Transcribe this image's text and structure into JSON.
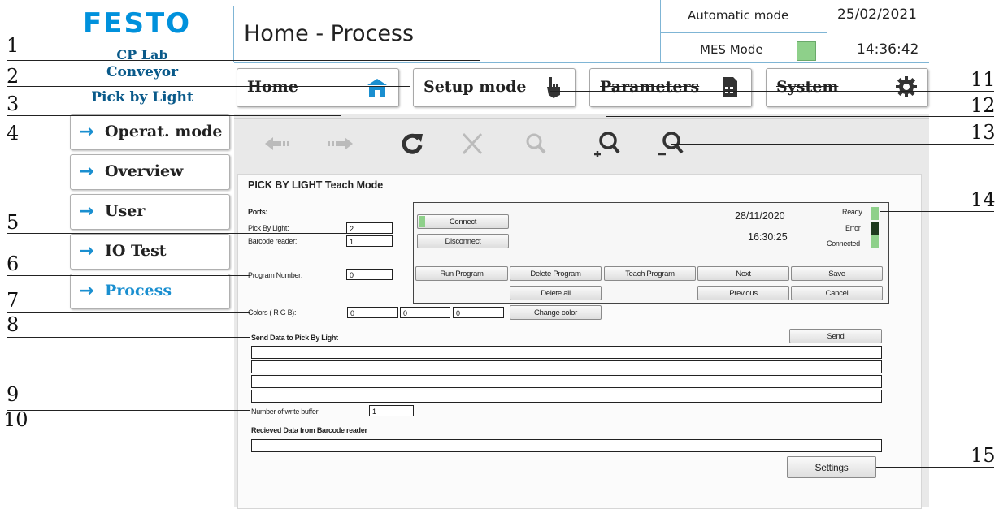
{
  "header": {
    "logo": "FESTO",
    "brand_line1": "CP Lab",
    "brand_line2": "Conveyor",
    "brand_line3": "Pick by Light",
    "title": "Home - Process",
    "mode_label": "Automatic mode",
    "mes_label": "MES Mode",
    "date": "25/02/2021",
    "time": "14:36:42",
    "mes_indicator_color": "#8ed08a"
  },
  "nav": {
    "home": "Home",
    "setup": "Setup mode",
    "parameters": "Parameters",
    "system": "System"
  },
  "sidebar": {
    "items": [
      {
        "label": "Operat. mode"
      },
      {
        "label": "Overview"
      },
      {
        "label": "User"
      },
      {
        "label": "IO Test"
      },
      {
        "label": "Process"
      }
    ]
  },
  "toolbar": {
    "icons": [
      "back-arrow-icon",
      "forward-arrow-icon",
      "refresh-icon",
      "cancel-x-icon",
      "search-icon",
      "zoom-in-icon",
      "zoom-out-icon"
    ]
  },
  "panel": {
    "title": "PICK BY LIGHT Teach Mode",
    "ports_label": "Ports:",
    "pbl_label": "Pick By Light:",
    "pbl_value": "2",
    "barcode_label": "Barcode reader:",
    "barcode_value": "1",
    "program_label": "Program Number:",
    "program_value": "0",
    "colors_label": "Colors ( R G B):",
    "color_r": "0",
    "color_g": "0",
    "color_b": "0",
    "change_color": "Change color",
    "send_section": "Send Data to Pick By Light",
    "send_button": "Send",
    "write_buffer_label": "Number of write buffer:",
    "write_buffer_value": "1",
    "received_section": "Recieved Data from Barcode reader",
    "settings_button": "Settings"
  },
  "control": {
    "connect": "Connect",
    "disconnect": "Disconnect",
    "date": "28/11/2020",
    "time": "16:30:25",
    "ready": "Ready",
    "error": "Error",
    "connected": "Connected",
    "run_program": "Run Program",
    "delete_program": "Delete Program",
    "teach_program": "Teach Program",
    "next": "Next",
    "save": "Save",
    "delete_all": "Delete all",
    "previous": "Previous",
    "cancel": "Cancel",
    "ready_color": "#8ed08a",
    "error_color": "#1e3a1e",
    "connected_color": "#8ed08a"
  },
  "callouts": [
    "1",
    "2",
    "3",
    "4",
    "5",
    "6",
    "7",
    "8",
    "9",
    "10",
    "11",
    "12",
    "13",
    "14",
    "15"
  ]
}
